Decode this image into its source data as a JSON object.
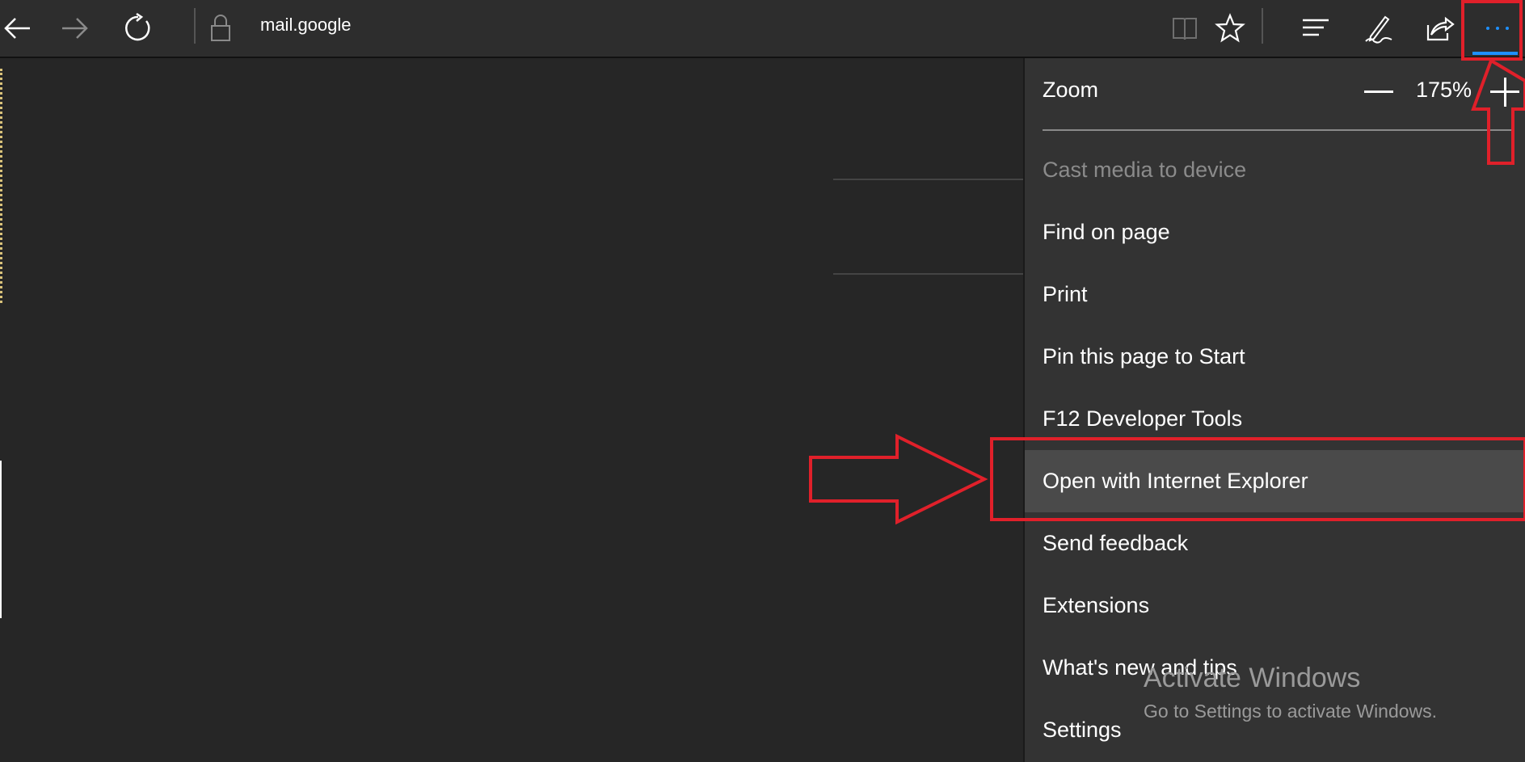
{
  "toolbar": {
    "url_host": "mail.google",
    "icons": [
      "back-icon",
      "forward-icon",
      "refresh-icon",
      "lock-icon",
      "reading-view-icon",
      "favorite-star-icon",
      "hub-icon",
      "web-note-icon",
      "share-icon",
      "more-icon"
    ],
    "accent_color": "#1e90ff"
  },
  "menu": {
    "zoom_label": "Zoom",
    "zoom_value": "175%",
    "items": [
      {
        "label": "Cast media to device",
        "disabled": true
      },
      {
        "label": "Find on page"
      },
      {
        "label": "Print"
      },
      {
        "label": "Pin this page to Start"
      },
      {
        "label": "F12 Developer Tools"
      },
      {
        "label": "Open with Internet Explorer",
        "highlighted": true
      },
      {
        "label": "Send feedback"
      },
      {
        "label": "Extensions"
      },
      {
        "label": "What's new and tips"
      },
      {
        "label": "Settings"
      }
    ]
  },
  "watermark": {
    "title": "Activate Windows",
    "subtitle": "Go to Settings to activate Windows."
  },
  "annotation_color": "#e0202a"
}
